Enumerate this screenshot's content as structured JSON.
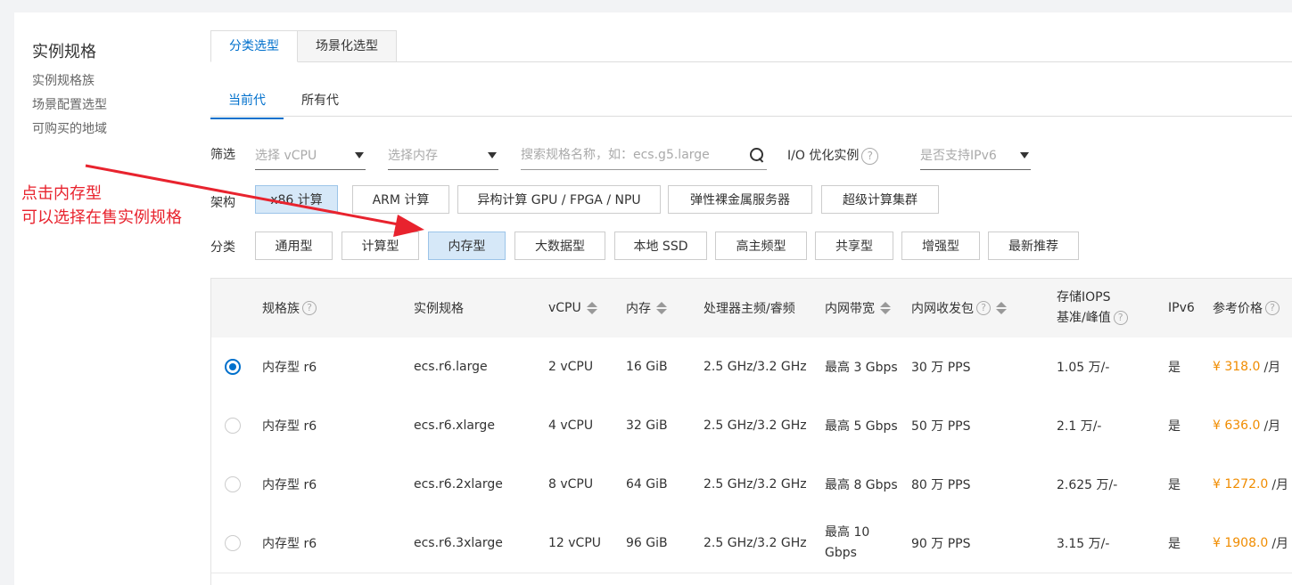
{
  "sidebar": {
    "title": "实例规格",
    "items": [
      "实例规格族",
      "场景配置选型",
      "可购买的地域"
    ]
  },
  "tabs": [
    "分类选型",
    "场景化选型"
  ],
  "subtabs": [
    "当前代",
    "所有代"
  ],
  "filter": {
    "label": "筛选",
    "vcpu_placeholder": "选择 vCPU",
    "mem_placeholder": "选择内存",
    "search_placeholder": "搜索规格名称，如：ecs.g5.large",
    "io_label": "I/O 优化实例",
    "ipv6_placeholder": "是否支持IPv6"
  },
  "arch": {
    "label": "架构",
    "options": [
      "x86 计算",
      "ARM 计算",
      "异构计算 GPU / FPGA / NPU",
      "弹性裸金属服务器",
      "超级计算集群"
    ]
  },
  "category": {
    "label": "分类",
    "options": [
      "通用型",
      "计算型",
      "内存型",
      "大数据型",
      "本地 SSD",
      "高主频型",
      "共享型",
      "增强型",
      "最新推荐"
    ]
  },
  "table": {
    "headers": {
      "family": "规格族",
      "spec": "实例规格",
      "vcpu": "vCPU",
      "mem": "内存",
      "freq": "处理器主频/睿频",
      "bw": "内网带宽",
      "pps": "内网收发包",
      "iops_line1": "存储IOPS",
      "iops_line2": "基准/峰值",
      "ipv6": "IPv6",
      "price": "参考价格"
    },
    "rows": [
      {
        "family": "内存型 r6",
        "spec": "ecs.r6.large",
        "vcpu": "2 vCPU",
        "mem": "16 GiB",
        "freq": "2.5 GHz/3.2 GHz",
        "bw": "最高 3 Gbps",
        "pps": "30 万 PPS",
        "iops": "1.05 万/-",
        "ipv6": "是",
        "price": "¥ 318.0",
        "unit": "/月"
      },
      {
        "family": "内存型 r6",
        "spec": "ecs.r6.xlarge",
        "vcpu": "4 vCPU",
        "mem": "32 GiB",
        "freq": "2.5 GHz/3.2 GHz",
        "bw": "最高 5 Gbps",
        "pps": "50 万 PPS",
        "iops": "2.1 万/-",
        "ipv6": "是",
        "price": "¥ 636.0",
        "unit": "/月"
      },
      {
        "family": "内存型 r6",
        "spec": "ecs.r6.2xlarge",
        "vcpu": "8 vCPU",
        "mem": "64 GiB",
        "freq": "2.5 GHz/3.2 GHz",
        "bw": "最高 8 Gbps",
        "pps": "80 万 PPS",
        "iops": "2.625 万/-",
        "ipv6": "是",
        "price": "¥ 1272.0",
        "unit": "/月"
      },
      {
        "family": "内存型 r6",
        "spec": "ecs.r6.3xlarge",
        "vcpu": "12 vCPU",
        "mem": "96 GiB",
        "freq": "2.5 GHz/3.2 GHz",
        "bw": "最高 10 Gbps",
        "pps": "90 万 PPS",
        "iops": "3.15 万/-",
        "ipv6": "是",
        "price": "¥ 1908.0",
        "unit": "/月"
      }
    ]
  },
  "annotation": {
    "line1": "点击内存型",
    "line2": "可以选择在售实例规格",
    "color": "#e8232e"
  },
  "colors": {
    "accent": "#0070cc",
    "price": "#f08c00",
    "selected_bg": "#d6e8f8"
  }
}
